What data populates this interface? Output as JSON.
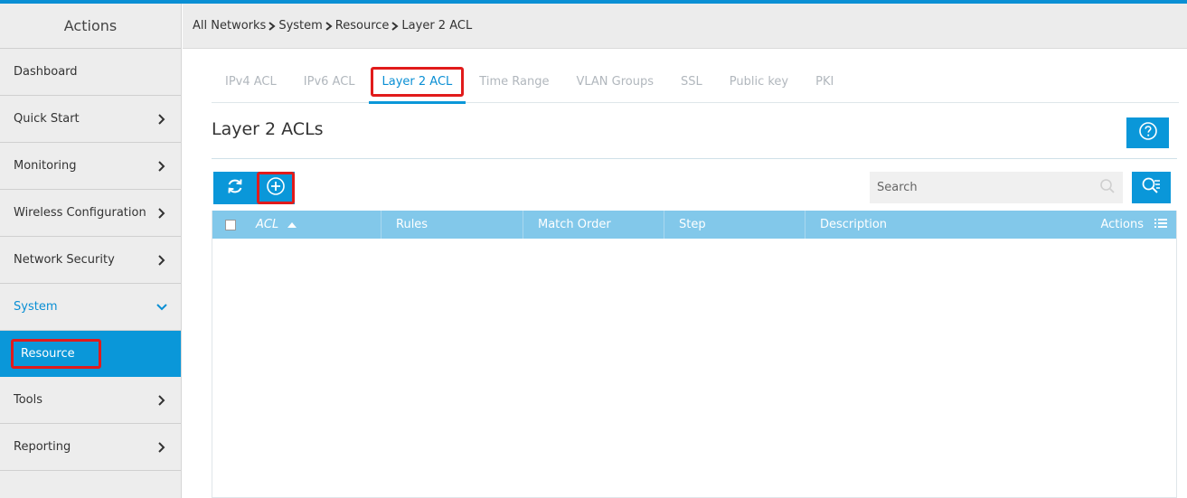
{
  "sidebar": {
    "header": "Actions",
    "items": [
      {
        "label": "Dashboard"
      },
      {
        "label": "Quick Start"
      },
      {
        "label": "Monitoring"
      },
      {
        "label": "Wireless Configuration"
      },
      {
        "label": "Network Security"
      },
      {
        "label": "System"
      },
      {
        "label": "Resource"
      },
      {
        "label": "Tools"
      },
      {
        "label": "Reporting"
      }
    ]
  },
  "breadcrumb": [
    "All Networks",
    "System",
    "Resource",
    "Layer 2 ACL"
  ],
  "tabs": [
    "IPv4 ACL",
    "IPv6 ACL",
    "Layer 2 ACL",
    "Time Range",
    "VLAN Groups",
    "SSL",
    "Public key",
    "PKI"
  ],
  "page": {
    "title": "Layer 2 ACLs"
  },
  "search": {
    "placeholder": "Search"
  },
  "grid": {
    "columns": [
      "ACL",
      "Rules",
      "Match Order",
      "Step",
      "Description"
    ],
    "actions_label": "Actions",
    "rows": []
  },
  "colors": {
    "accent": "#0a97d9",
    "highlight": "#e11b1b",
    "grid_header": "#82c8ea"
  },
  "icons": {
    "refresh": "refresh-icon",
    "add": "add-circle-icon",
    "help": "help-icon",
    "search": "search-icon",
    "advanced_search": "advanced-search-icon",
    "actions_menu": "list-menu-icon",
    "chevron": "chevron-right-icon"
  }
}
